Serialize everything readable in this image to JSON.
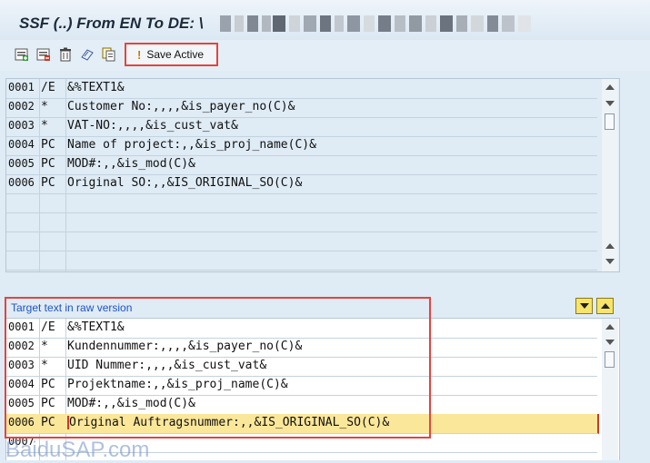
{
  "window": {
    "title": "SSF (..) From EN To DE: \\"
  },
  "toolbar": {
    "icons": [
      "new-line-icon",
      "delete-line-icon",
      "trash-icon",
      "replace-icon",
      "copy-icon"
    ],
    "save_label": "Save Active"
  },
  "source_editor": {
    "rows": [
      {
        "num": "0001",
        "fmt": "/E",
        "text": "&%TEXT1&"
      },
      {
        "num": "0002",
        "fmt": "*",
        "text": "Customer No:,,,,&is_payer_no(C)&"
      },
      {
        "num": "0003",
        "fmt": "*",
        "text": "VAT-NO:,,,,&is_cust_vat&"
      },
      {
        "num": "0004",
        "fmt": "PC",
        "text": "Name of project:,,&is_proj_name(C)&"
      },
      {
        "num": "0005",
        "fmt": "PC",
        "text": "MOD#:,,&is_mod(C)&"
      },
      {
        "num": "0006",
        "fmt": "PC",
        "text": "Original SO:,,&IS_ORIGINAL_SO(C)&"
      }
    ]
  },
  "target_editor": {
    "label": "Target text in raw version",
    "rows": [
      {
        "num": "0001",
        "fmt": "/E",
        "text": "&%TEXT1&"
      },
      {
        "num": "0002",
        "fmt": "*",
        "text": "Kundennummer:,,,,&is_payer_no(C)&"
      },
      {
        "num": "0003",
        "fmt": "*",
        "text": "UID Nummer:,,,,&is_cust_vat&"
      },
      {
        "num": "0004",
        "fmt": "PC",
        "text": "Projektname:,,&is_proj_name(C)&"
      },
      {
        "num": "0005",
        "fmt": "PC",
        "text": "MOD#:,,&is_mod(C)&"
      },
      {
        "num": "0006",
        "fmt": "PC",
        "text": "Original Auftragsnummer:,,&IS_ORIGINAL_SO(C)&"
      },
      {
        "num": "0007",
        "fmt": "",
        "text": ""
      }
    ]
  },
  "watermark": "BaiduSAP.com",
  "colors": {
    "highlight_border": "#e0463f",
    "active_row": "#fbe79a",
    "label_blue": "#1f52c4"
  }
}
